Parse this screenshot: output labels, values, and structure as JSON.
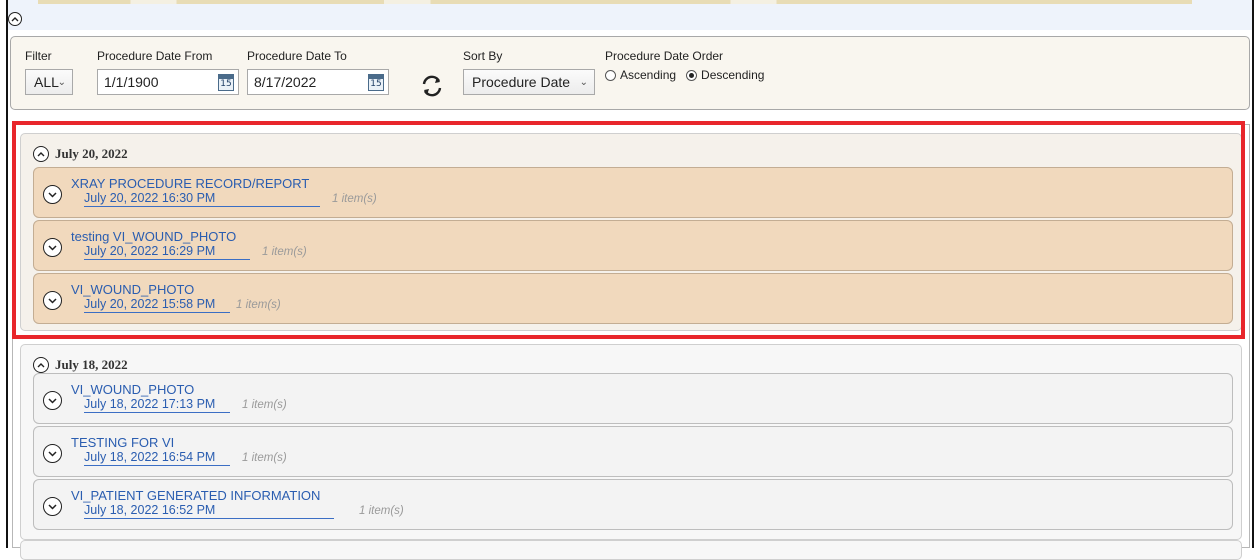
{
  "filter_panel": {
    "filter": {
      "label": "Filter",
      "value": "ALL"
    },
    "date_from": {
      "label": "Procedure Date From",
      "value": "1/1/1900",
      "cal_num": "15"
    },
    "date_to": {
      "label": "Procedure Date To",
      "value": "8/17/2022",
      "cal_num": "15"
    },
    "sort_by": {
      "label": "Sort By",
      "value": "Procedure Date"
    },
    "date_order": {
      "label": "Procedure Date Order",
      "ascending": "Ascending",
      "descending": "Descending",
      "selected": "Descending"
    }
  },
  "groups": [
    {
      "date": "July 20, 2022",
      "items": [
        {
          "title": "XRAY PROCEDURE RECORD/REPORT",
          "datetime": "July 20, 2022 16:30 PM",
          "count": "1 item(s)"
        },
        {
          "title": "testing VI_WOUND_PHOTO",
          "datetime": "July 20, 2022 16:29 PM",
          "count": "1 item(s)"
        },
        {
          "title": "VI_WOUND_PHOTO",
          "datetime": "July 20, 2022 15:58 PM",
          "count": "1 item(s)"
        }
      ]
    },
    {
      "date": "July 18, 2022",
      "items": [
        {
          "title": "VI_WOUND_PHOTO",
          "datetime": "July 18, 2022 17:13 PM",
          "count": "1 item(s)"
        },
        {
          "title": "TESTING FOR VI",
          "datetime": "July 18, 2022 16:54 PM",
          "count": "1 item(s)"
        },
        {
          "title": "VI_PATIENT GENERATED INFORMATION",
          "datetime": "July 18, 2022 16:52 PM",
          "count": "1 item(s)"
        }
      ]
    }
  ],
  "colors": {
    "highlight": "#e8262b",
    "link": "#2a5db0",
    "selected_group_bg": "#f1d9bd"
  }
}
